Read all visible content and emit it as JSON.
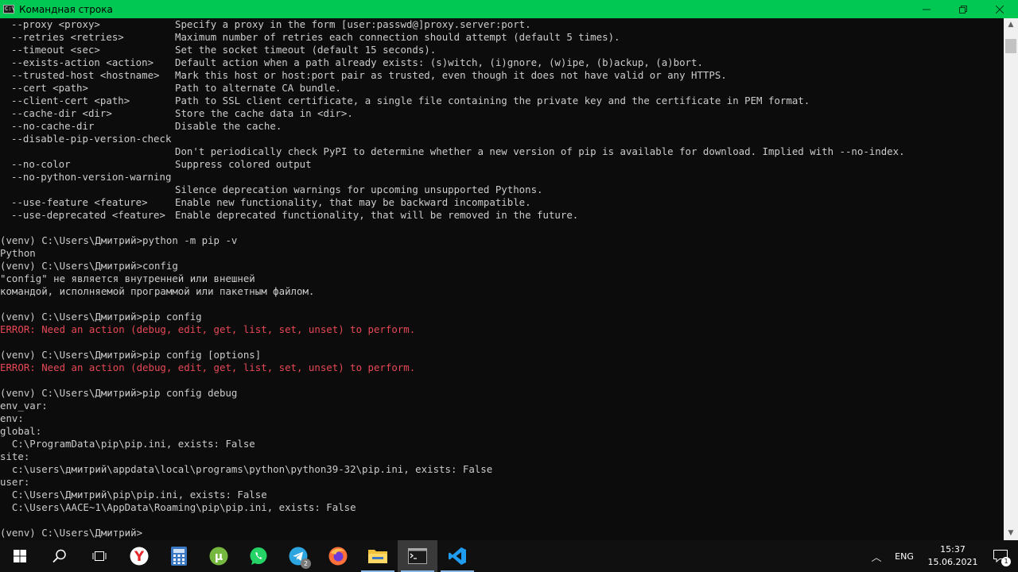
{
  "window": {
    "title": "Командная строка",
    "icon": "cmd-icon",
    "controls": [
      "minimize-icon",
      "maximize-icon",
      "close-icon"
    ]
  },
  "console": {
    "options": [
      {
        "opt": "--proxy <proxy>",
        "desc": "Specify a proxy in the form [user:passwd@]proxy.server:port."
      },
      {
        "opt": "--retries <retries>",
        "desc": "Maximum number of retries each connection should attempt (default 5 times)."
      },
      {
        "opt": "--timeout <sec>",
        "desc": "Set the socket timeout (default 15 seconds)."
      },
      {
        "opt": "--exists-action <action>",
        "desc": "Default action when a path already exists: (s)witch, (i)gnore, (w)ipe, (b)ackup, (a)bort."
      },
      {
        "opt": "--trusted-host <hostname>",
        "desc": "Mark this host or host:port pair as trusted, even though it does not have valid or any HTTPS."
      },
      {
        "opt": "--cert <path>",
        "desc": "Path to alternate CA bundle."
      },
      {
        "opt": "--client-cert <path>",
        "desc": "Path to SSL client certificate, a single file containing the private key and the certificate in PEM format."
      },
      {
        "opt": "--cache-dir <dir>",
        "desc": "Store the cache data in <dir>."
      },
      {
        "opt": "--no-cache-dir",
        "desc": "Disable the cache."
      },
      {
        "opt": "--disable-pip-version-check",
        "desc": ""
      },
      {
        "opt": "",
        "desc": "Don't periodically check PyPI to determine whether a new version of pip is available for download. Implied with --no-index."
      },
      {
        "opt": "--no-color",
        "desc": "Suppress colored output"
      },
      {
        "opt": "--no-python-version-warning",
        "desc": ""
      },
      {
        "opt": "",
        "desc": "Silence deprecation warnings for upcoming unsupported Pythons."
      },
      {
        "opt": "--use-feature <feature>",
        "desc": "Enable new functionality, that may be backward incompatible."
      },
      {
        "opt": "--use-deprecated <feature>",
        "desc": "Enable deprecated functionality, that will be removed in the future."
      }
    ],
    "lines": [
      {
        "text": "",
        "kind": "normal"
      },
      {
        "text": "(venv) C:\\Users\\Дмитрий>python -m pip -v",
        "kind": "normal"
      },
      {
        "text": "Python",
        "kind": "normal"
      },
      {
        "text": "(venv) C:\\Users\\Дмитрий>config",
        "kind": "normal"
      },
      {
        "text": "\"config\" не является внутренней или внешней",
        "kind": "normal"
      },
      {
        "text": "командой, исполняемой программой или пакетным файлом.",
        "kind": "normal"
      },
      {
        "text": "",
        "kind": "normal"
      },
      {
        "text": "(venv) C:\\Users\\Дмитрий>pip config",
        "kind": "normal"
      },
      {
        "text": "ERROR: Need an action (debug, edit, get, list, set, unset) to perform.",
        "kind": "error"
      },
      {
        "text": "",
        "kind": "normal"
      },
      {
        "text": "(venv) C:\\Users\\Дмитрий>pip config [options]",
        "kind": "normal"
      },
      {
        "text": "ERROR: Need an action (debug, edit, get, list, set, unset) to perform.",
        "kind": "error"
      },
      {
        "text": "",
        "kind": "normal"
      },
      {
        "text": "(venv) C:\\Users\\Дмитрий>pip config debug",
        "kind": "normal"
      },
      {
        "text": "env_var:",
        "kind": "normal"
      },
      {
        "text": "env:",
        "kind": "normal"
      },
      {
        "text": "global:",
        "kind": "normal"
      },
      {
        "text": "  C:\\ProgramData\\pip\\pip.ini, exists: False",
        "kind": "normal"
      },
      {
        "text": "site:",
        "kind": "normal"
      },
      {
        "text": "  c:\\users\\дмитрий\\appdata\\local\\programs\\python\\python39-32\\pip.ini, exists: False",
        "kind": "normal"
      },
      {
        "text": "user:",
        "kind": "normal"
      },
      {
        "text": "  C:\\Users\\Дмитрий\\pip\\pip.ini, exists: False",
        "kind": "normal"
      },
      {
        "text": "  C:\\Users\\AACE~1\\AppData\\Roaming\\pip\\pip.ini, exists: False",
        "kind": "normal"
      },
      {
        "text": "",
        "kind": "normal"
      },
      {
        "text": "(venv) C:\\Users\\Дмитрий>",
        "kind": "normal"
      }
    ],
    "colors": {
      "background": "#0c0c0c",
      "text": "#cccccc",
      "error": "#e74856"
    }
  },
  "taskbar": {
    "apps": [
      {
        "name": "start-button",
        "icon": "windows-logo-icon"
      },
      {
        "name": "search-button",
        "icon": "search-icon"
      },
      {
        "name": "task-view-button",
        "icon": "task-view-icon"
      },
      {
        "name": "yandex-browser-button",
        "icon": "yandex-icon"
      },
      {
        "name": "calculator-button",
        "icon": "calculator-icon"
      },
      {
        "name": "utorrent-button",
        "icon": "utorrent-icon"
      },
      {
        "name": "whatsapp-button",
        "icon": "whatsapp-icon"
      },
      {
        "name": "telegram-button",
        "icon": "telegram-icon",
        "badge": "2"
      },
      {
        "name": "firefox-button",
        "icon": "firefox-icon"
      },
      {
        "name": "file-explorer-button",
        "icon": "folder-icon"
      },
      {
        "name": "command-prompt-button",
        "icon": "cmd-icon"
      },
      {
        "name": "vscode-button",
        "icon": "vscode-icon"
      }
    ],
    "tray": {
      "language": "ENG",
      "time": "15:37",
      "date": "15.06.2021",
      "notification_count": "1"
    },
    "accent": "#86b7e8"
  }
}
